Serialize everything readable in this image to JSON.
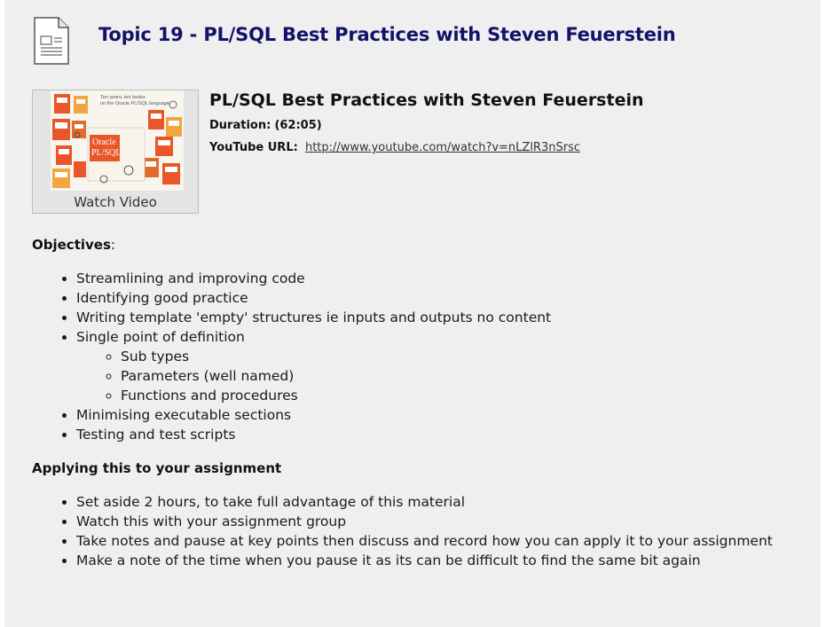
{
  "header": {
    "icon": "document-icon",
    "title": "Topic 19 - PL/SQL Best Practices with Steven Feuerstein"
  },
  "video": {
    "thumbnail_text": [
      "Ten years, ten books",
      "on the Oracle PL/SQL language",
      "Oracle",
      "PL/SQL"
    ],
    "watch_label": "Watch Video",
    "title": "PL/SQL Best Practices with Steven Feuerstein",
    "duration_label": "Duration:",
    "duration_value": "(62:05)",
    "url_label": "YouTube URL:",
    "url": "http://www.youtube.com/watch?v=nLZlR3nSrsc"
  },
  "objectives": {
    "heading": "Objectives",
    "heading_suffix": ":",
    "items": [
      "Streamlining and improving code",
      "Identifying good practice",
      "Writing template 'empty' structures ie inputs and outputs no content",
      "Single point of definition",
      "Minimising executable sections",
      "Testing and test scripts"
    ],
    "subitems": [
      "Sub types",
      "Parameters (well named)",
      "Functions and procedures"
    ]
  },
  "assignment": {
    "heading": "Applying this to your assignment",
    "items": [
      "Set aside 2 hours, to take full advantage of this material",
      "Watch this with your assignment group",
      "Take notes and pause at key points then discuss and record how you can apply it to your assignment",
      "Make a note of the time when you pause it as its can be difficult to find the same bit again"
    ]
  },
  "colors": {
    "title": "#13126a",
    "panel": "#efefef",
    "thumb_accent": "#e8562a"
  }
}
